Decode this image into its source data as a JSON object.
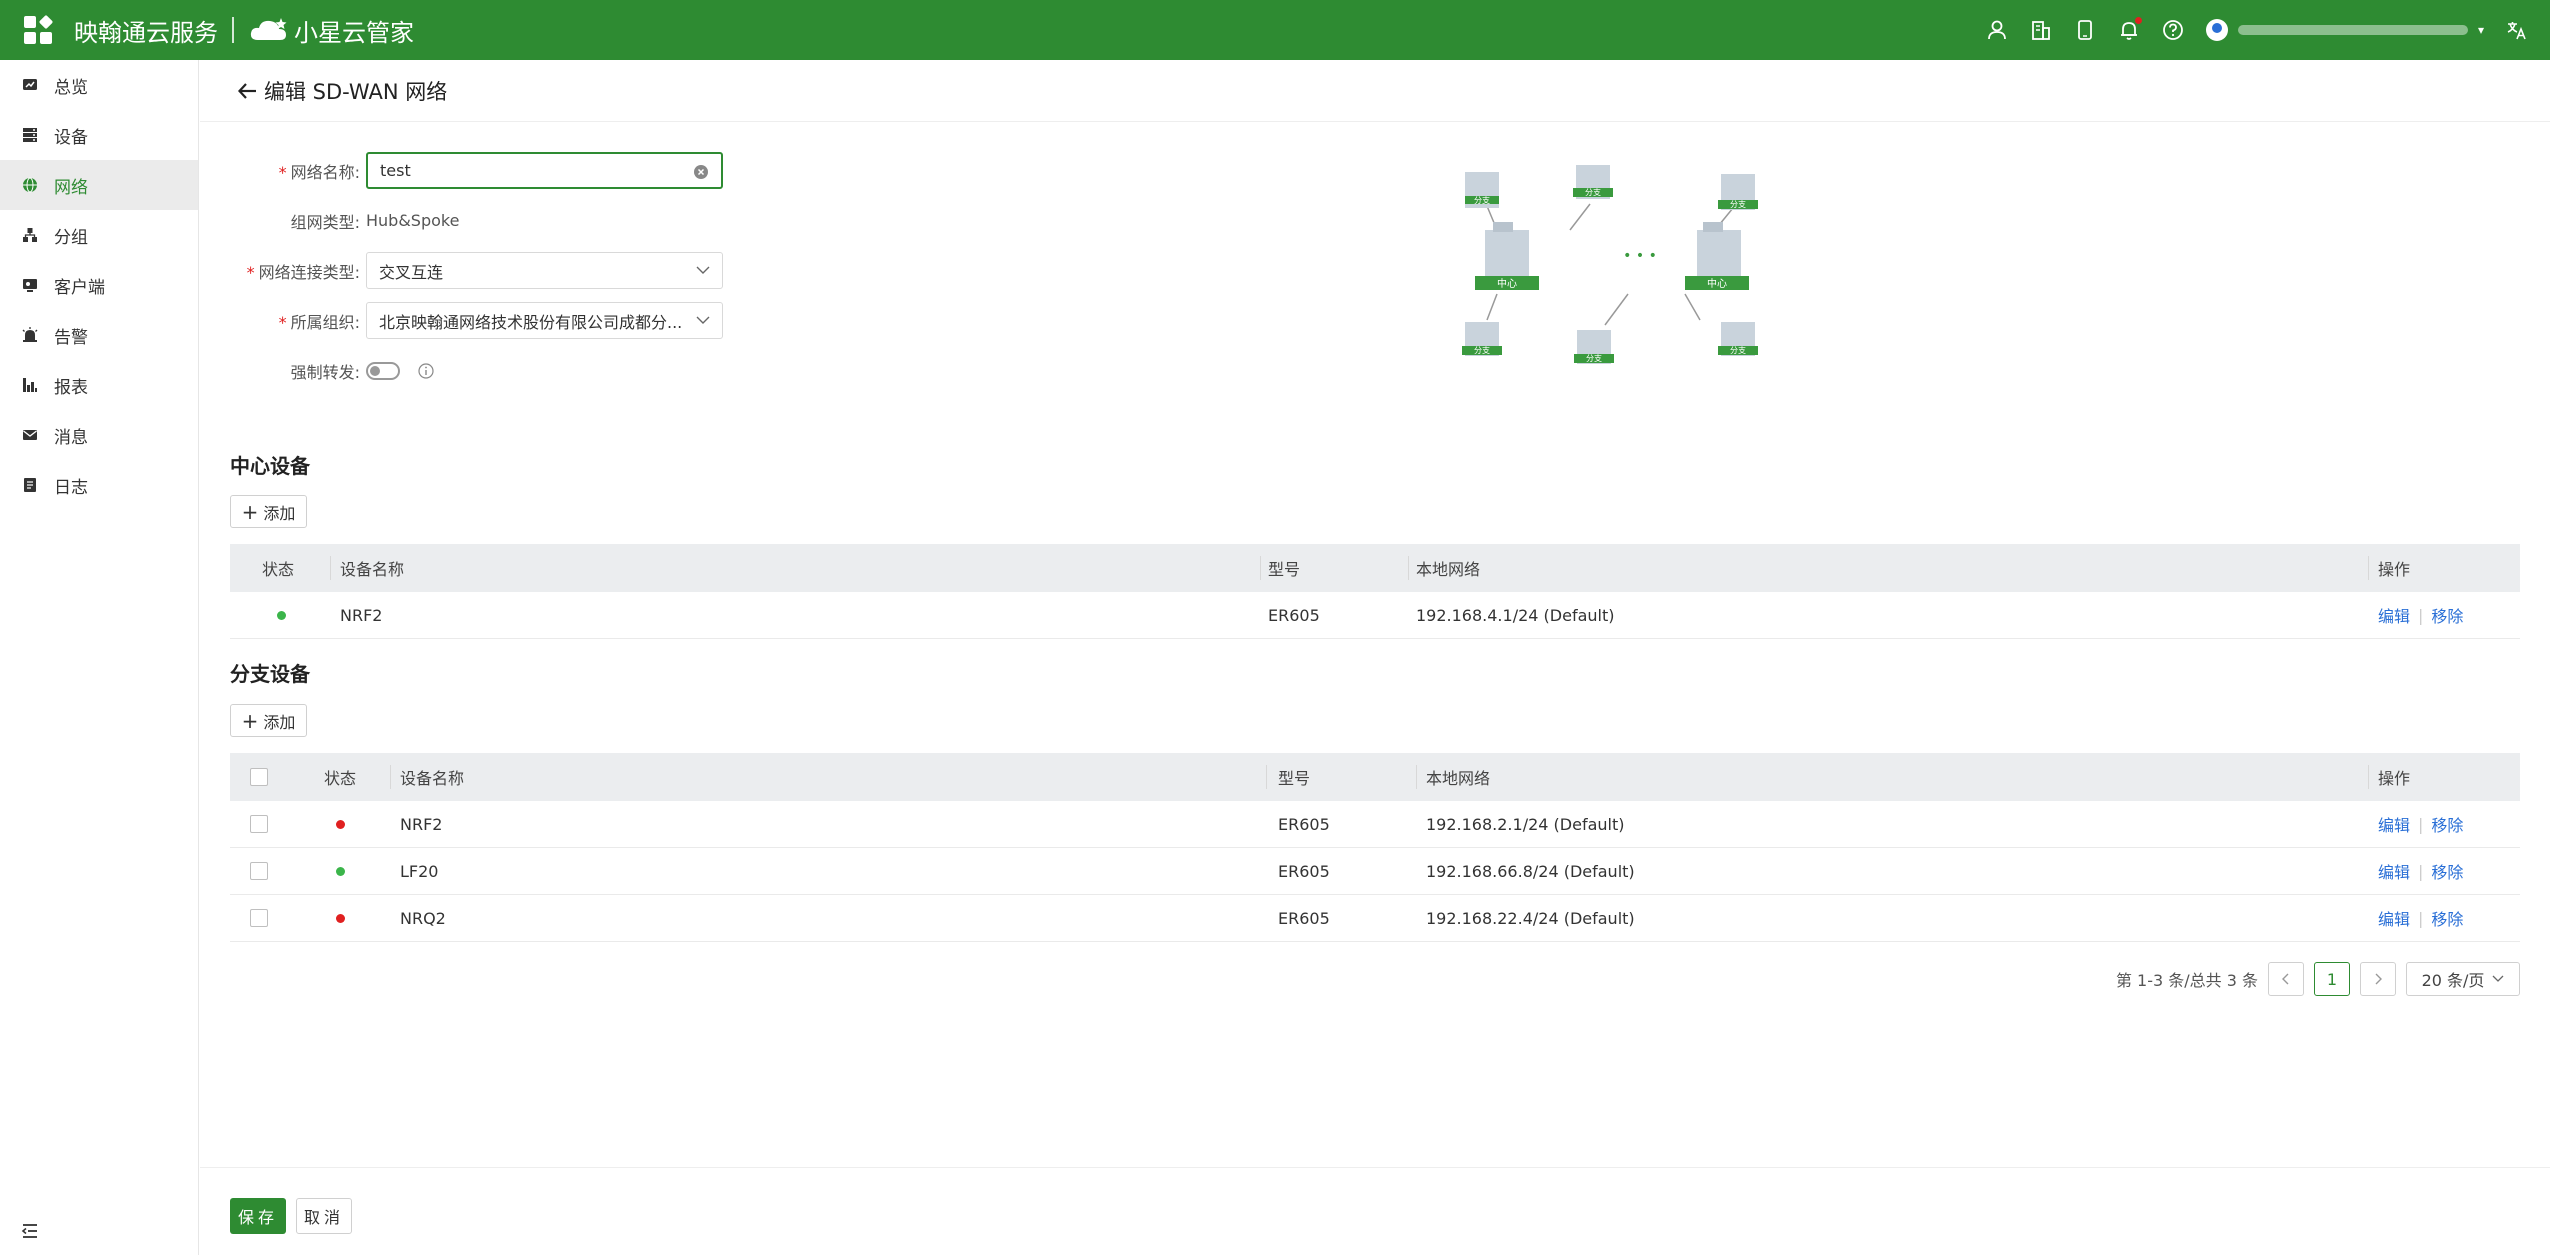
{
  "app": {
    "brand": "映翰通云服务",
    "brand2": "小星云管家",
    "accent_color": "#2e8b32"
  },
  "topbar_icons": [
    "user-icon",
    "building-icon",
    "device-icon",
    "bell-icon",
    "help-icon",
    "translate-icon"
  ],
  "sidebar": {
    "items": [
      {
        "label": "总览",
        "icon": "dashboard-icon"
      },
      {
        "label": "设备",
        "icon": "device-list-icon"
      },
      {
        "label": "网络",
        "icon": "globe-icon"
      },
      {
        "label": "分组",
        "icon": "group-icon"
      },
      {
        "label": "客户端",
        "icon": "client-icon"
      },
      {
        "label": "告警",
        "icon": "alarm-icon"
      },
      {
        "label": "报表",
        "icon": "report-icon"
      },
      {
        "label": "消息",
        "icon": "message-icon"
      },
      {
        "label": "日志",
        "icon": "log-icon"
      }
    ],
    "active_index": 2
  },
  "page": {
    "title": "编辑 SD-WAN 网络"
  },
  "form": {
    "name_label": "网络名称:",
    "name_value": "test",
    "type_label": "组网类型:",
    "type_value": "Hub&Spoke",
    "conn_label": "网络连接类型:",
    "conn_value": "交叉互连",
    "org_label": "所属组织:",
    "org_value": "北京映翰通网络技术股份有限公司成都分...",
    "force_label": "强制转发:",
    "force_on": false
  },
  "topology": {
    "hub_label": "中心",
    "branch_label": "分支",
    "ellipsis": "• • •"
  },
  "hub_section": {
    "title": "中心设备",
    "add_label": "添加",
    "columns": [
      "状态",
      "设备名称",
      "型号",
      "本地网络",
      "操作"
    ],
    "rows": [
      {
        "status": "online",
        "name": "NRF2",
        "model": "ER605",
        "network": "192.168.4.1/24  (Default)",
        "edit": "编辑",
        "remove": "移除"
      }
    ]
  },
  "branch_section": {
    "title": "分支设备",
    "add_label": "添加",
    "columns": [
      "状态",
      "设备名称",
      "型号",
      "本地网络",
      "操作"
    ],
    "rows": [
      {
        "status": "offline",
        "name": "NRF2",
        "model": "ER605",
        "network": "192.168.2.1/24  (Default)",
        "edit": "编辑",
        "remove": "移除"
      },
      {
        "status": "online",
        "name": "LF20",
        "model": "ER605",
        "network": "192.168.66.8/24  (Default)",
        "edit": "编辑",
        "remove": "移除"
      },
      {
        "status": "offline",
        "name": "NRQ2",
        "model": "ER605",
        "network": "192.168.22.4/24  (Default)",
        "edit": "编辑",
        "remove": "移除"
      }
    ]
  },
  "pager": {
    "summary": "第 1-3 条/总共 3 条",
    "current_page": "1",
    "page_size": "20 条/页"
  },
  "footer": {
    "save_label": "保存",
    "cancel_label": "取消"
  }
}
